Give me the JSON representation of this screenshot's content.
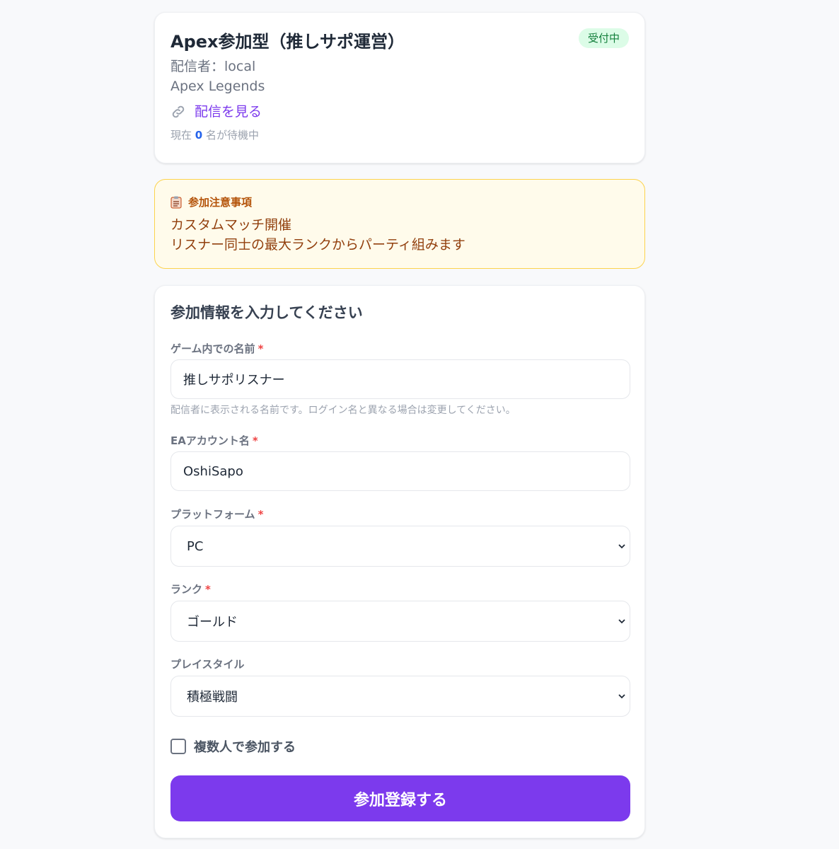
{
  "event": {
    "title": "Apex参加型（推しサポ運営）",
    "status": "受付中",
    "streamer": "配信者：local",
    "game": "Apex Legends",
    "watch_link": "配信を見る",
    "waiting_prefix": "現在",
    "waiting_count": "0",
    "waiting_suffix": "名が待機中"
  },
  "notice": {
    "title": "参加注意事項",
    "lines": [
      "カスタムマッチ開催",
      "リスナー同士の最大ランクからパーティ組みます"
    ]
  },
  "form": {
    "title": "参加情報を入力してください",
    "ingame_name": {
      "label": "ゲーム内での名前",
      "required": "*",
      "value": "推しサポリスナー",
      "help": "配信者に表示される名前です。ログイン名と異なる場合は変更してください。"
    },
    "ea_account": {
      "label": "EAアカウント名",
      "required": "*",
      "value": "OshiSapo"
    },
    "platform": {
      "label": "プラットフォーム",
      "required": "*",
      "value": "PC"
    },
    "rank": {
      "label": "ランク",
      "required": "*",
      "value": "ゴールド"
    },
    "playstyle": {
      "label": "プレイスタイル",
      "value": "積極戦闘"
    },
    "multi_checkbox": "複数人で参加する",
    "submit": "参加登録する"
  },
  "colors": {
    "accent": "#7c3aed",
    "status_bg": "#dcfce7",
    "status_fg": "#15803d",
    "notice_bg": "#fffbeb",
    "notice_fg": "#92400e",
    "required": "#ef4444"
  },
  "icons": {
    "link": "link-icon",
    "clipboard": "clipboard-icon",
    "chevron": "chevron-down-icon"
  }
}
